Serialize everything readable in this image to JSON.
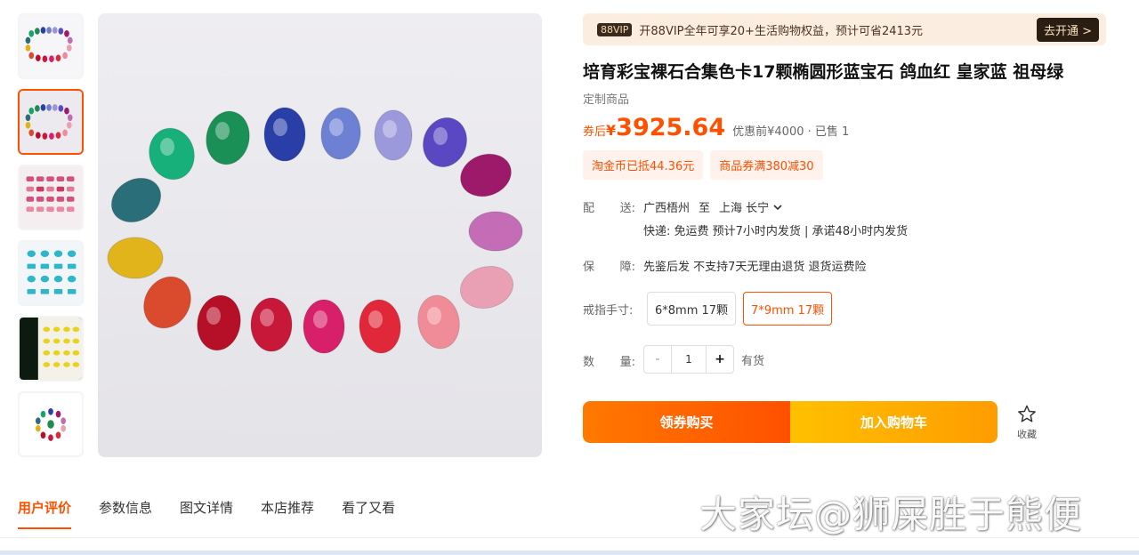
{
  "vip": {
    "badge": "88VIP",
    "text": "开88VIP全年可享20+生活购物权益，预计可省2413元",
    "button": "去开通 >"
  },
  "product": {
    "title": "培育彩宝裸石合集色卡17颗椭圆形蓝宝石 鸽血红 皇家蓝 祖母绿",
    "custom_tag": "定制商品"
  },
  "price": {
    "prefix": "券后",
    "currency": "¥",
    "value": "3925.64",
    "meta": "优惠前¥4000 · 已售 1"
  },
  "coupons": [
    "淘金币已抵44.36元",
    "商品券满380减30"
  ],
  "shipping": {
    "label_a": "配",
    "label_b": "送:",
    "from": "广西梧州",
    "to_word": "至",
    "destination": "上海 长宁",
    "detail": "快递: 免运费   预计7小时内发货 | 承诺48小时内发货"
  },
  "guarantee": {
    "label_a": "保",
    "label_b": "障:",
    "text": "先鉴后发  不支持7天无理由退货  退货运费险"
  },
  "ring_size": {
    "label": "戒指手寸:",
    "options": [
      "6*8mm 17颗",
      "7*9mm 17颗"
    ],
    "selected": "7*9mm 17颗"
  },
  "quantity": {
    "label_a": "数",
    "label_b": "量:",
    "minus": "-",
    "value": "1",
    "plus": "+",
    "stock": "有货"
  },
  "actions": {
    "coupon_buy": "领券购买",
    "add_cart": "加入购物车",
    "favorite": "收藏",
    "favorite_icon": "star-outline"
  },
  "tabs": [
    "用户评价",
    "参数信息",
    "图文详情",
    "本店推荐",
    "看了又看"
  ],
  "watermark": "大家坛@狮屎胜于熊便",
  "colors": {
    "accent": "#ff5000",
    "cart": "#ffb000"
  }
}
